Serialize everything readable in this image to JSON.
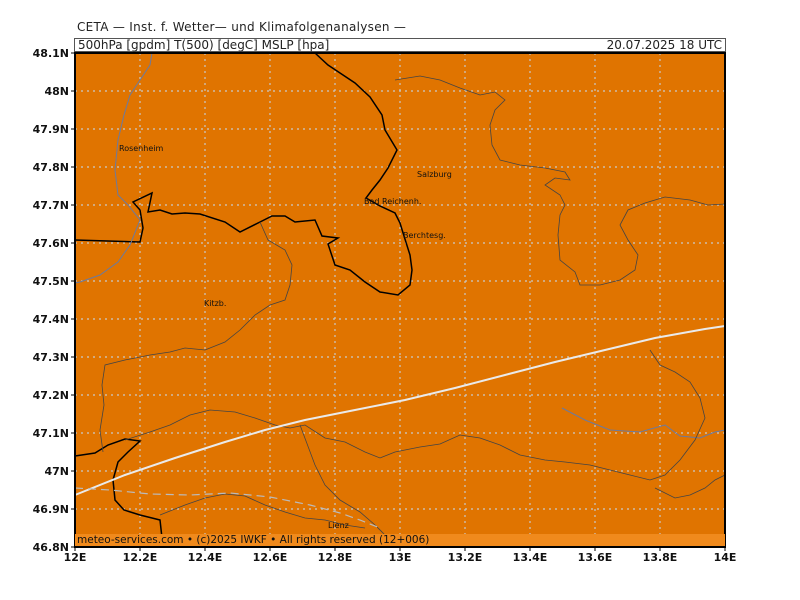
{
  "header": {
    "title": "CETA — Inst. f. Wetter— und Klimafolgenanalysen —",
    "params": "500hPa [gpdm] T(500) [degC] MSLP [hpa]",
    "valid_time": "20.07.2025 18 UTC"
  },
  "colors": {
    "fill": "#e07400",
    "grid": "#c8c8c8",
    "border": "#000000",
    "river": "#5a6a8a",
    "contour": "#e8e8e8",
    "footer_bg": "#f08a1c"
  },
  "axes": {
    "lat_labels": [
      "48.1N",
      "48N",
      "47.9N",
      "47.8N",
      "47.7N",
      "47.6N",
      "47.5N",
      "47.4N",
      "47.3N",
      "47.2N",
      "47.1N",
      "47N",
      "46.9N",
      "46.8N"
    ],
    "lon_labels": [
      "12E",
      "12.2E",
      "12.4E",
      "12.6E",
      "12.8E",
      "13E",
      "13.2E",
      "13.4E",
      "13.6E",
      "13.8E",
      "14E"
    ]
  },
  "cities": [
    "Rosenheim",
    "Salzburg",
    "Bad Reichenh.",
    "Berchtesg.",
    "Kitzb.",
    "Lienz"
  ],
  "footer": "meteo-services.com • (c)2025 IWKF • All rights reserved (12+006)"
}
